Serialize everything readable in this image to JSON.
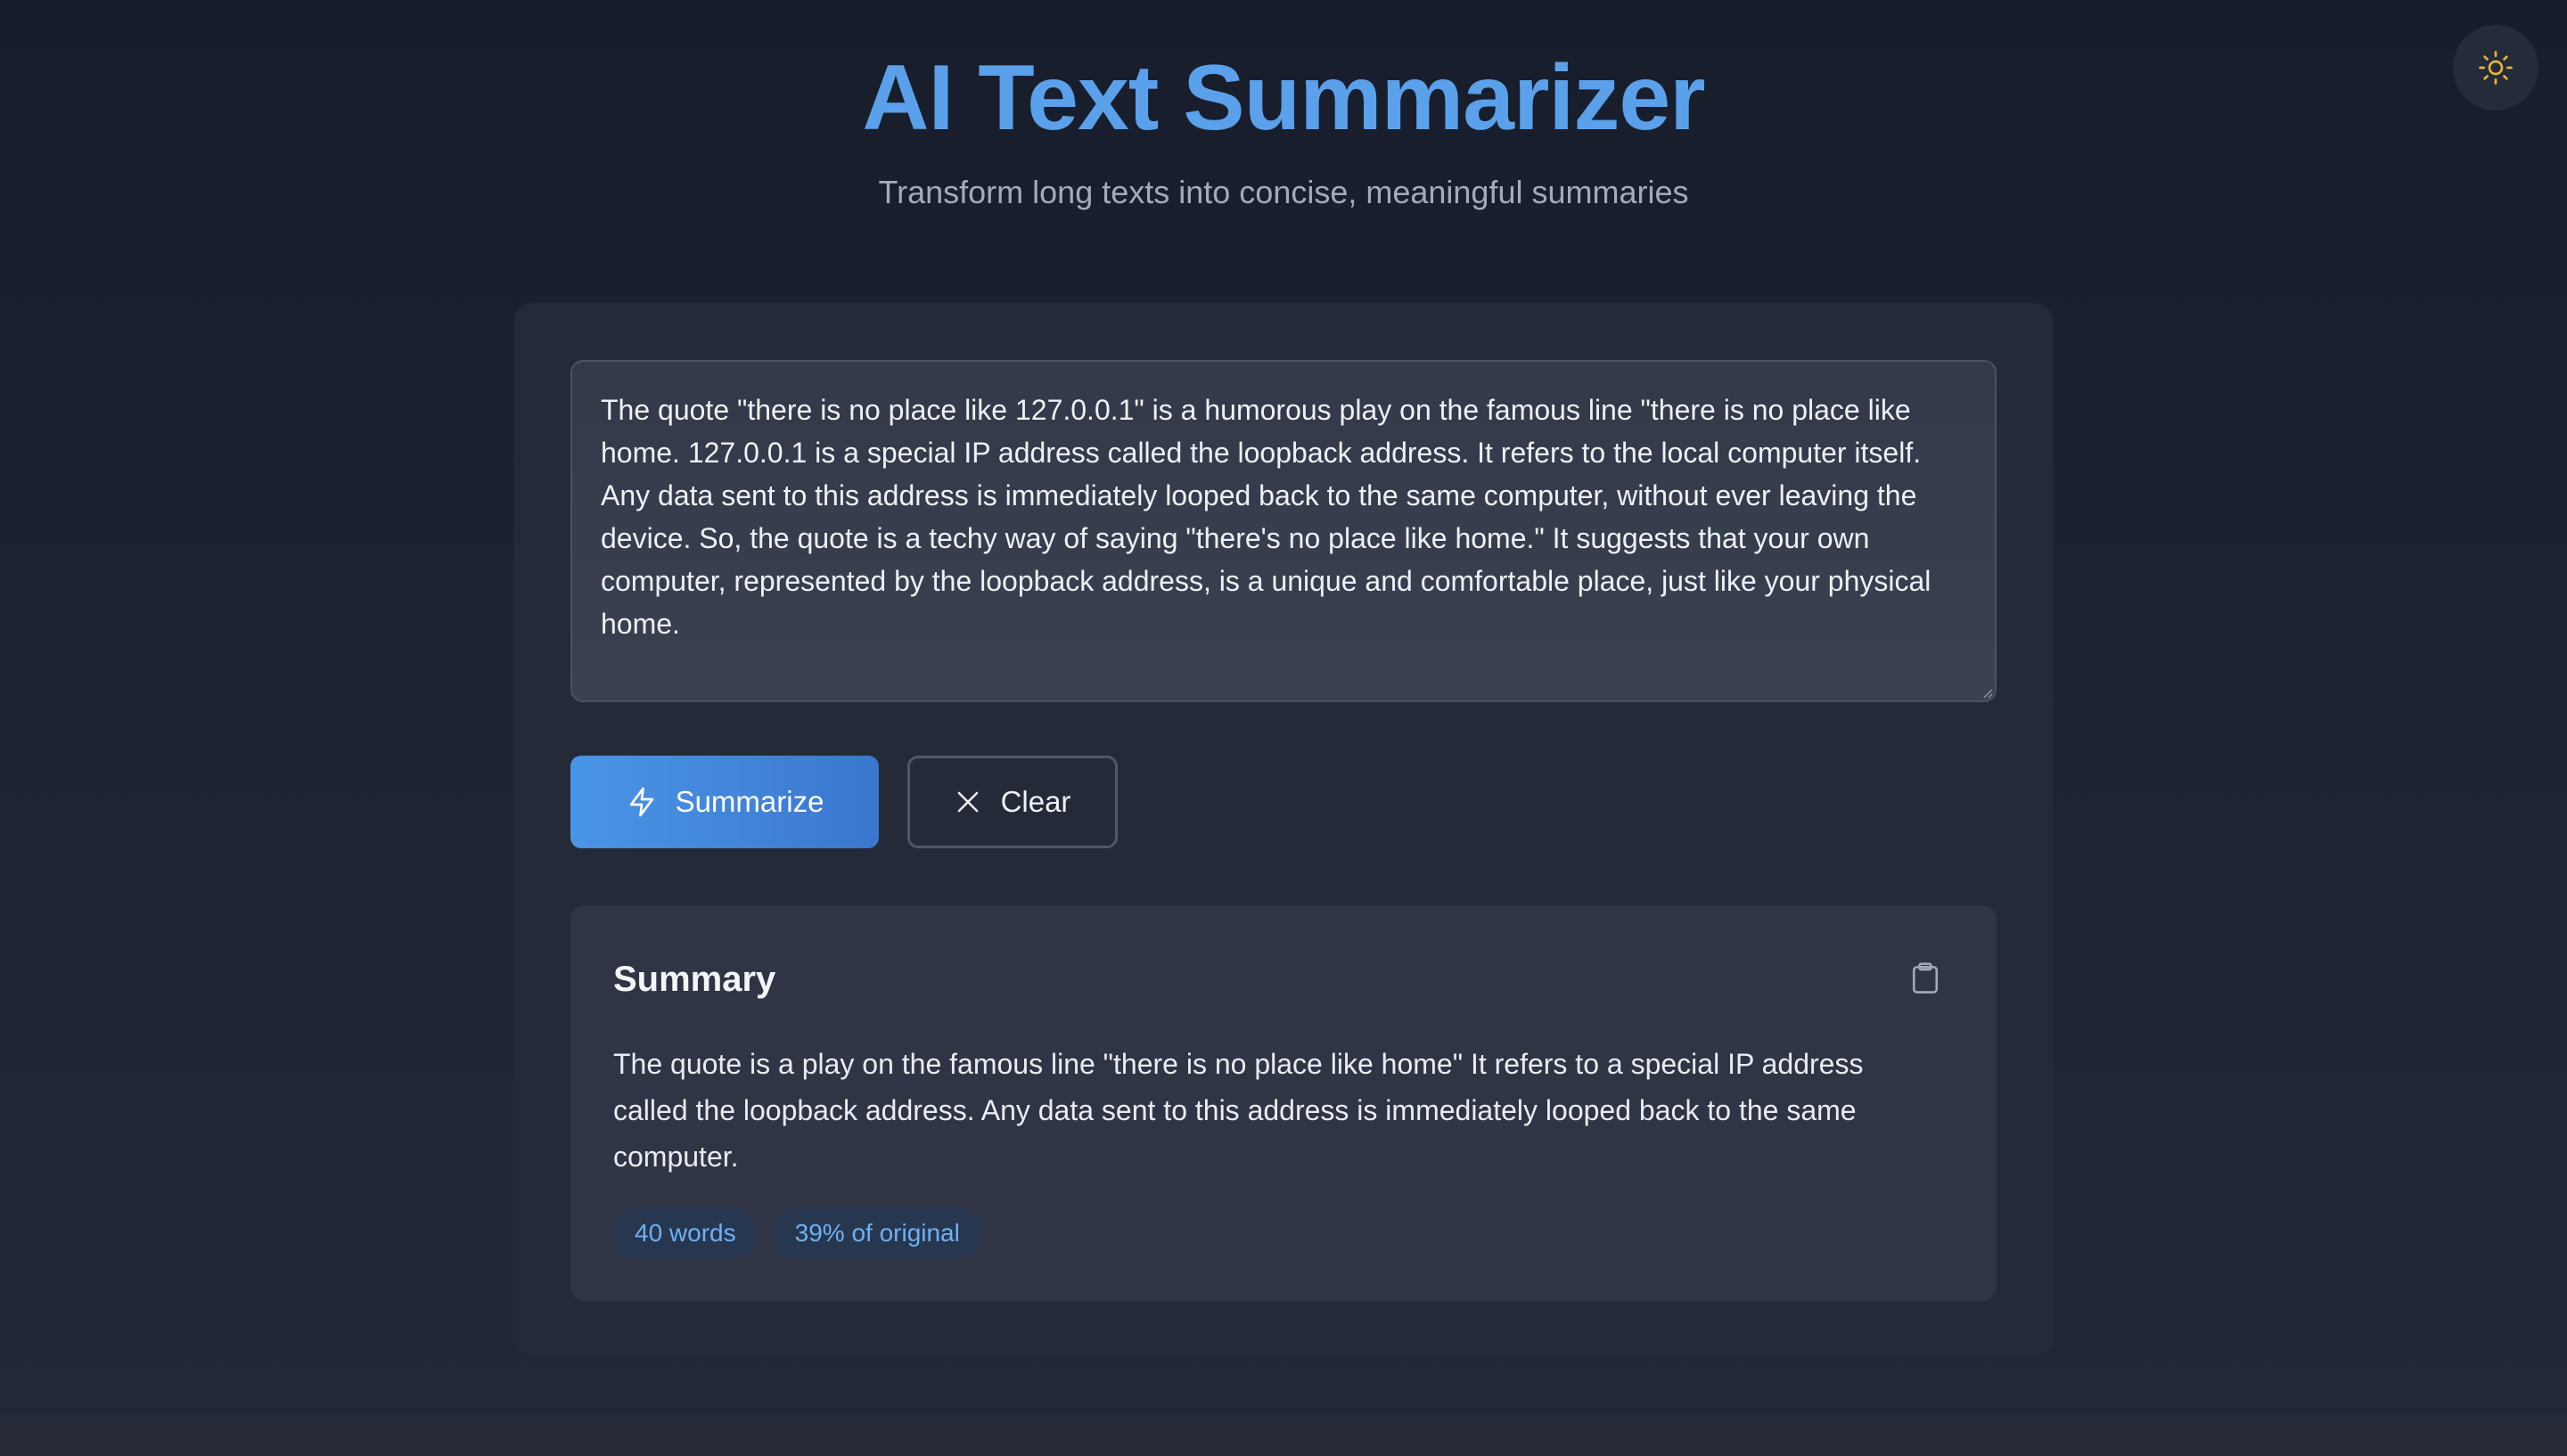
{
  "header": {
    "title": "AI Text Summarizer",
    "subtitle": "Transform long texts into concise, meaningful summaries",
    "theme_toggle_icon": "sun-icon"
  },
  "input": {
    "value": "The quote \"there is no place like 127.0.0.1\" is a humorous play on the famous line \"there is no place like home. 127.0.0.1 is a special IP address called the loopback address. It refers to the local computer itself. Any data sent to this address is immediately looped back to the same computer, without ever leaving the device. So, the quote is a techy way of saying \"there's no place like home.\" It suggests that your own computer, represented by the loopback address, is a unique and comfortable place, just like your physical home."
  },
  "actions": {
    "summarize_label": "Summarize",
    "summarize_icon": "lightning-icon",
    "clear_label": "Clear",
    "clear_icon": "close-icon"
  },
  "summary": {
    "title": "Summary",
    "copy_icon": "clipboard-icon",
    "text": "The quote is a play on the famous line \"there is no place like home\" It refers to a special IP address called the loopback address. Any data sent to this address is immediately looped back to the same computer.",
    "word_count": "40 words",
    "ratio": "39% of original"
  },
  "colors": {
    "accent": "#5aa0ea",
    "button_gradient_start": "#4b95e6",
    "button_gradient_end": "#3a77cf",
    "sun_icon": "#e8b23a"
  }
}
